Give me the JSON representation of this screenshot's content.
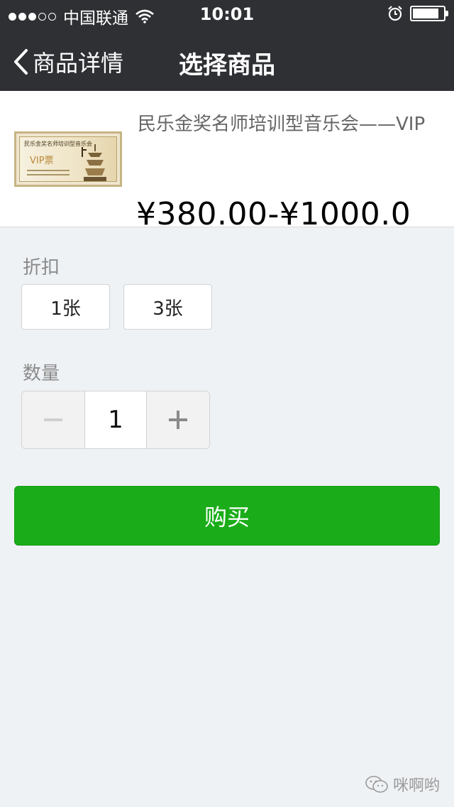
{
  "status_bar": {
    "carrier": "中国联通",
    "time": "10:01",
    "signal_strength": 3,
    "signal_max": 5,
    "battery_level": 0.85
  },
  "nav": {
    "back_label": "商品详情",
    "title": "选择商品"
  },
  "product": {
    "title": "民乐金奖名师培训型音乐会——VIP",
    "price": "¥380.00-¥1000.0",
    "thumbnail": {
      "title_text": "民乐金奖名师培训型音乐会",
      "badge_text": "VIP票"
    }
  },
  "discount": {
    "label": "折扣",
    "options": [
      "1张",
      "3张"
    ]
  },
  "quantity": {
    "label": "数量",
    "value": "1"
  },
  "buy_button": {
    "label": "购买"
  },
  "watermark": {
    "text": "咪啊哟"
  },
  "colors": {
    "bar_background": "#2f3034",
    "buy_green": "#1aad19",
    "page_background": "#eff2f5"
  }
}
